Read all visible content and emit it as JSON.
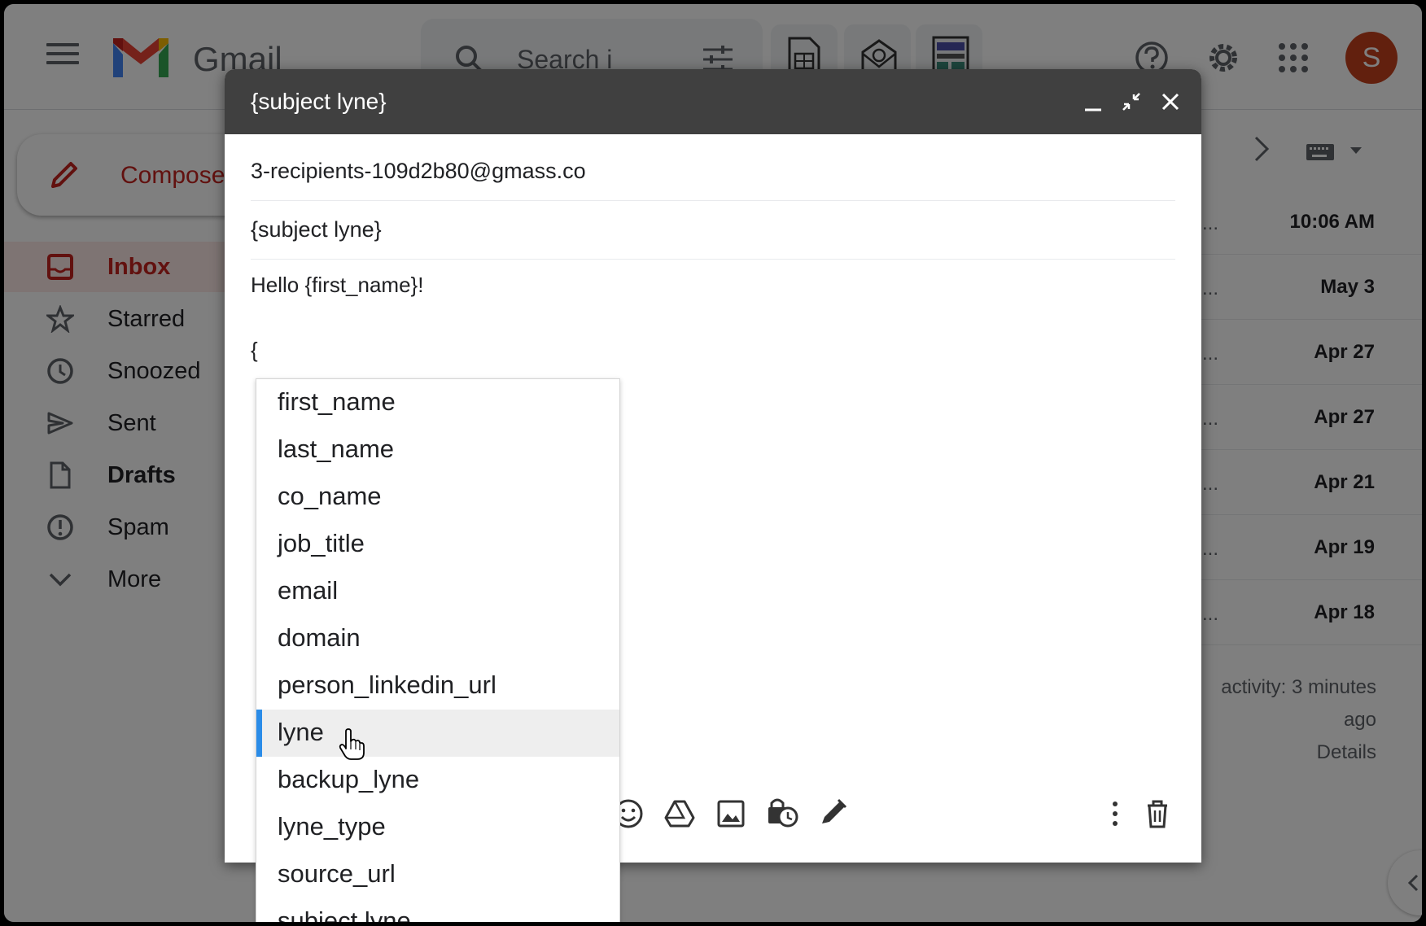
{
  "app": {
    "logo_text": "Gmail",
    "search_placeholder": "Search i",
    "avatar_letter": "S",
    "accent": "#c5221f",
    "avatar_color": "#c5401d"
  },
  "sidebar": {
    "compose_label": "Compose",
    "items": [
      {
        "label": "Inbox",
        "icon": "inbox-icon"
      },
      {
        "label": "Starred",
        "icon": "star-icon"
      },
      {
        "label": "Snoozed",
        "icon": "clock-icon"
      },
      {
        "label": "Sent",
        "icon": "send-icon"
      },
      {
        "label": "Drafts",
        "icon": "draft-icon"
      },
      {
        "label": "Spam",
        "icon": "spam-icon"
      },
      {
        "label": "More",
        "icon": "chevron-down-icon"
      }
    ]
  },
  "mail_list": {
    "dates": [
      "10:06 AM",
      "May 3",
      "Apr 27",
      "Apr 27",
      "Apr 21",
      "Apr 19",
      "Apr 18"
    ],
    "ellipsis": "...",
    "activity_line1": "activity: 3 minutes",
    "activity_line2": "ago",
    "details_link": "Details"
  },
  "compose": {
    "title": "{subject lyne}",
    "to": "3-recipients-109d2b80@gmass.co",
    "subject": "{subject lyne}",
    "body_line1": "Hello {first_name}!",
    "body_line2": "{"
  },
  "dropdown": {
    "items": [
      "first_name",
      "last_name",
      "co_name",
      "job_title",
      "email",
      "domain",
      "person_linkedin_url",
      "lyne",
      "backup_lyne",
      "lyne_type",
      "source_url",
      "subject lyne"
    ],
    "selected_index": 7,
    "highlight_color": "#2a8ce8"
  }
}
